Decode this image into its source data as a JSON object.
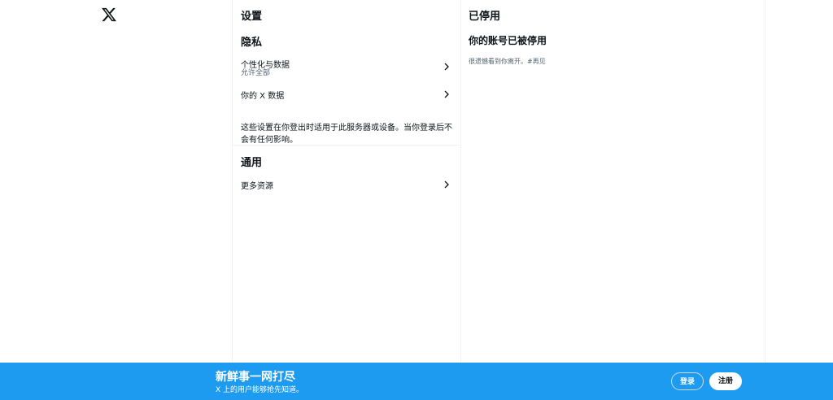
{
  "brand": {
    "logo_icon": "x-logo-icon"
  },
  "settings": {
    "title": "设置",
    "privacy": {
      "title": "隐私",
      "items": [
        {
          "label": "个性化与数据",
          "sublabel": "允许全部",
          "icon": "chevron-right-icon"
        },
        {
          "label": "你的 X 数据",
          "icon": "chevron-right-icon"
        }
      ],
      "note": "这些设置在你登出时适用于此服务器或设备。当你登录后不会有任何影响。"
    },
    "general": {
      "title": "通用",
      "items": [
        {
          "label": "更多资源",
          "icon": "chevron-right-icon"
        }
      ]
    }
  },
  "detail": {
    "title": "已停用",
    "heading": "你的账号已被停用",
    "message": "很遗憾看到你离开。#再见"
  },
  "banner": {
    "title": "新鲜事一网打尽",
    "subtitle": "X 上的用户能够抢先知道。",
    "login_label": "登录",
    "signup_label": "注册"
  },
  "colors": {
    "accent": "#1d9bf0",
    "text": "#0f1419",
    "muted": "#536471",
    "border": "#eff3f4"
  }
}
